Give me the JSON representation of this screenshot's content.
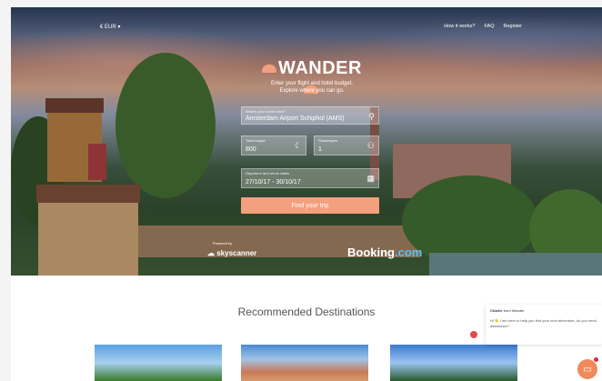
{
  "nav": {
    "currency": "€ EUR ▾",
    "links": [
      "How it works?",
      "FAQ",
      "Register"
    ]
  },
  "brand": {
    "name": "WANDER",
    "tagline_1": "Enter your flight and hotel budget.",
    "tagline_2": "Explore where you can go."
  },
  "form": {
    "home_label": "What's your home base?",
    "home_value": "Amsterdam Airport Schiphol (AMS)",
    "budget_label": "Total budget",
    "budget_value": "800",
    "passengers_label": "Passengers",
    "passengers_value": "1",
    "dates_label": "Departure and return dates",
    "dates_value": "27/10/17 - 30/10/17",
    "submit": "Find your trip"
  },
  "partners": {
    "powered_by": "Powered by",
    "skyscanner": "skyscanner",
    "booking_main": "Booking",
    "booking_ext": ".com"
  },
  "recommended": {
    "title": "Recommended Destinations"
  },
  "chat": {
    "name": "Charlie",
    "from": "from Wander",
    "message": "Hi 👋 I am here to help you find your next adventure, do you need assistance?"
  },
  "colors": {
    "accent": "#f3a07e",
    "booking_accent": "#58c3f0"
  }
}
